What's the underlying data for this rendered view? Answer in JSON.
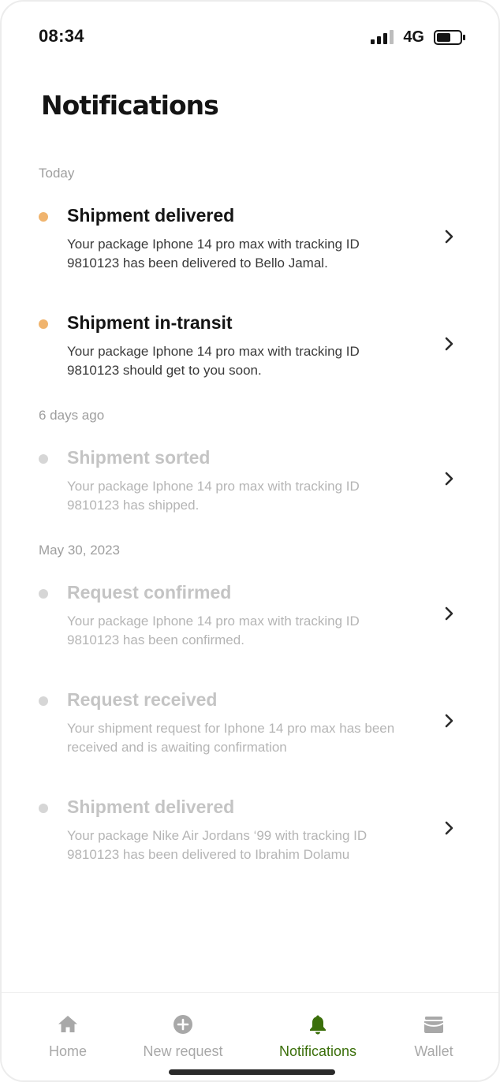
{
  "status_bar": {
    "time": "08:34",
    "network": "4G",
    "battery_level": 0.6,
    "signal_bars": 3
  },
  "page": {
    "title": "Notifications"
  },
  "colors": {
    "unread_dot": "#f0b46e",
    "read_dot": "#d6d6d6",
    "active_tab": "#3b6f0a",
    "inactive_tab": "#a8a8a8"
  },
  "sections": [
    {
      "label": "Today",
      "items": [
        {
          "title": "Shipment delivered",
          "body": "Your package Iphone 14 pro max with tracking ID 9810123 has been delivered to Bello Jamal.",
          "unread": true
        },
        {
          "title": "Shipment in-transit",
          "body": "Your package Iphone 14 pro max with tracking ID 9810123 should get to you soon.",
          "unread": true
        }
      ]
    },
    {
      "label": "6 days ago",
      "items": [
        {
          "title": "Shipment sorted",
          "body": "Your package Iphone 14 pro max with tracking ID 9810123 has shipped.",
          "unread": false
        }
      ]
    },
    {
      "label": "May 30, 2023",
      "items": [
        {
          "title": "Request confirmed",
          "body": "Your package Iphone 14 pro max with tracking ID 9810123 has been confirmed.",
          "unread": false
        },
        {
          "title": "Request received",
          "body": "Your shipment request for Iphone 14 pro max has been received and is awaiting confirmation",
          "unread": false
        },
        {
          "title": "Shipment delivered",
          "body": "Your package Nike Air Jordans ‘99 with tracking ID 9810123 has been delivered to Ibrahim Dolamu",
          "unread": false
        }
      ]
    }
  ],
  "tabbar": {
    "tabs": [
      {
        "label": "Home",
        "icon": "home-icon",
        "active": false
      },
      {
        "label": "New request",
        "icon": "plus-circle-icon",
        "active": false
      },
      {
        "label": "Notifications",
        "icon": "bell-icon",
        "active": true
      },
      {
        "label": "Wallet",
        "icon": "wallet-icon",
        "active": false
      }
    ]
  }
}
